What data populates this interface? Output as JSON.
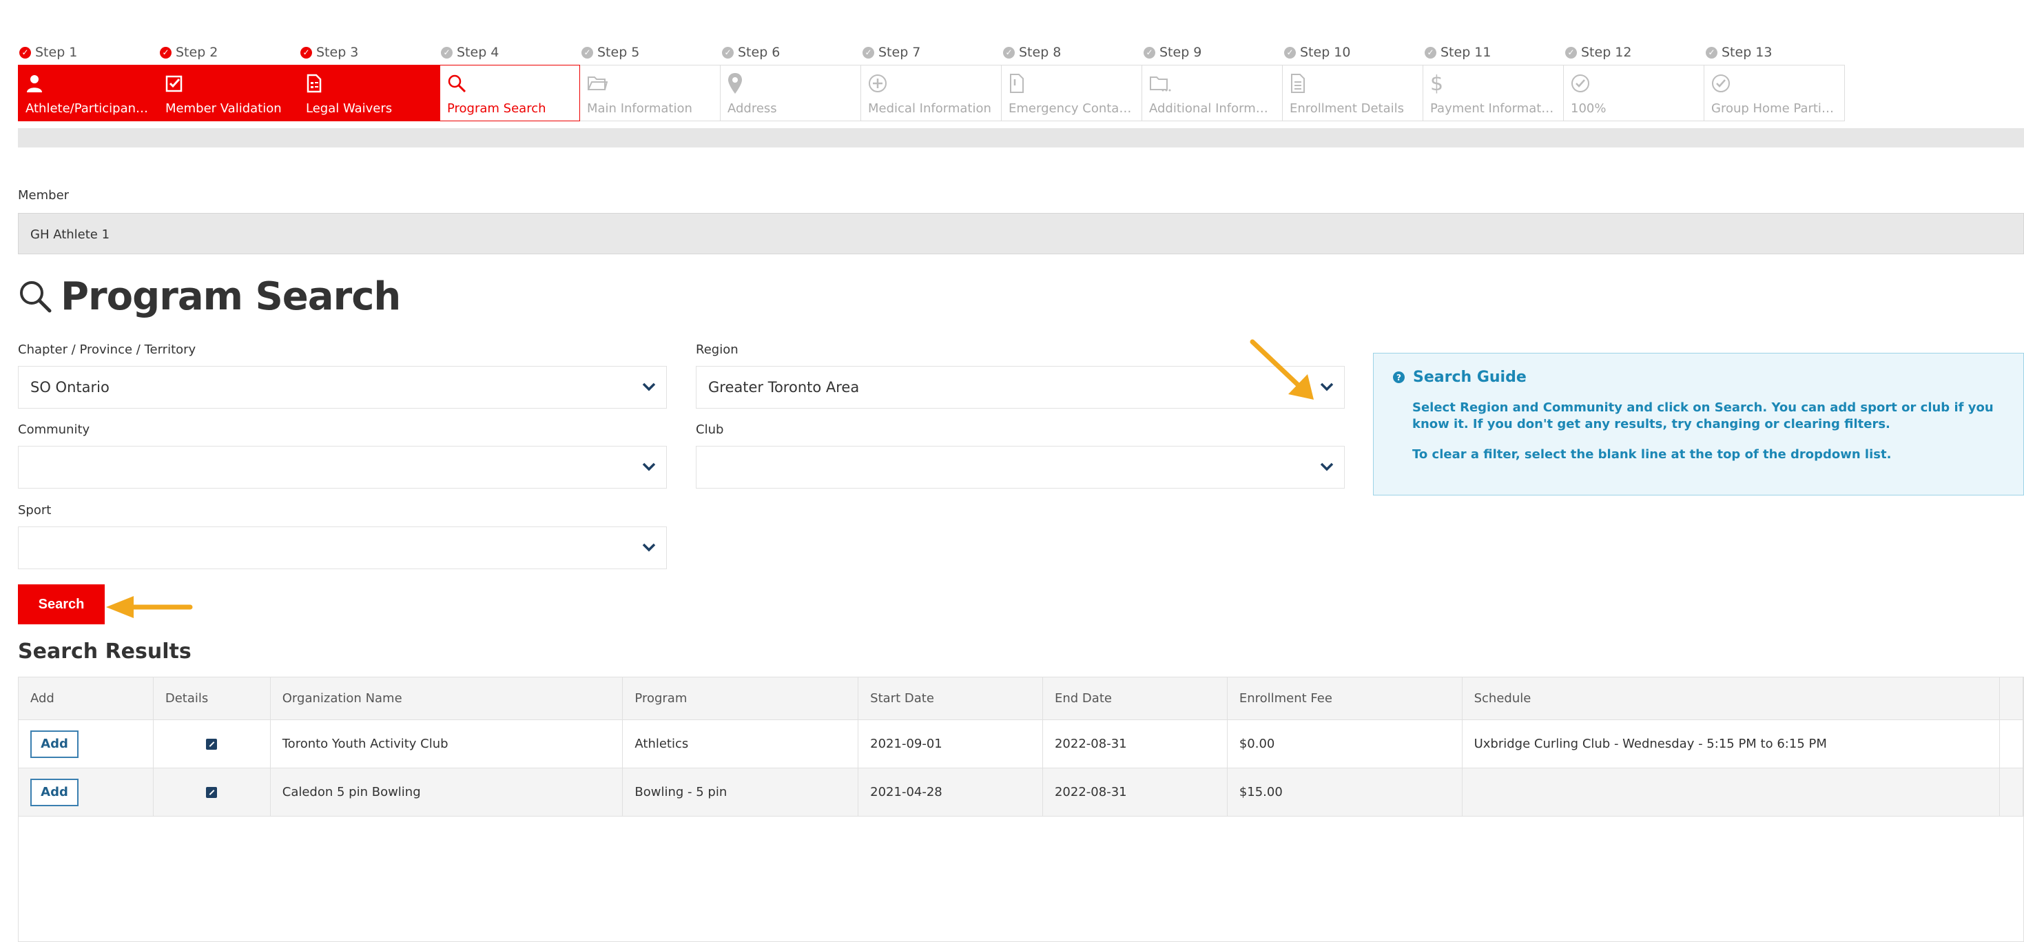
{
  "steps": [
    {
      "step": "Step 1",
      "label": "Athlete/Participant Info",
      "icon": "person-icon",
      "state": "done"
    },
    {
      "step": "Step 2",
      "label": "Member Validation",
      "icon": "checkbox-icon",
      "state": "done"
    },
    {
      "step": "Step 3",
      "label": "Legal Waivers",
      "icon": "document-icon",
      "state": "done"
    },
    {
      "step": "Step 4",
      "label": "Program Search",
      "icon": "search-icon",
      "state": "active"
    },
    {
      "step": "Step 5",
      "label": "Main Information",
      "icon": "folder-icon",
      "state": "pending"
    },
    {
      "step": "Step 6",
      "label": "Address",
      "icon": "map-pin-icon",
      "state": "pending"
    },
    {
      "step": "Step 7",
      "label": "Medical Information",
      "icon": "plus-circle-icon",
      "state": "pending"
    },
    {
      "step": "Step 8",
      "label": "Emergency Contacts",
      "icon": "doc-alert-icon",
      "state": "pending"
    },
    {
      "step": "Step 9",
      "label": "Additional Information",
      "icon": "folder-dots-icon",
      "state": "pending"
    },
    {
      "step": "Step 10",
      "label": "Enrollment Details",
      "icon": "file-lines-icon",
      "state": "pending"
    },
    {
      "step": "Step 11",
      "label": "Payment Information",
      "icon": "dollar-icon",
      "state": "pending"
    },
    {
      "step": "Step 12",
      "label": "100%",
      "icon": "check-circle-icon",
      "state": "pending"
    },
    {
      "step": "Step 13",
      "label": "Group Home Particip...",
      "icon": "check-circle-icon",
      "state": "pending"
    }
  ],
  "member": {
    "label": "Member",
    "value": "GH Athlete 1"
  },
  "page_title": "Program Search",
  "filters": {
    "chapter": {
      "label": "Chapter / Province / Territory",
      "value": "SO Ontario"
    },
    "region": {
      "label": "Region",
      "value": "Greater Toronto Area"
    },
    "community": {
      "label": "Community",
      "value": ""
    },
    "club": {
      "label": "Club",
      "value": ""
    },
    "sport": {
      "label": "Sport",
      "value": ""
    }
  },
  "guide": {
    "title": "Search Guide",
    "p1": "Select Region and Community and click on Search. You can add sport or club if you know it. If you don't get any results, try changing or clearing filters.",
    "p2": "To clear a filter, select the blank line at the top of the dropdown list."
  },
  "search_label": "Search",
  "results": {
    "title": "Search Results",
    "headers": [
      "Add",
      "Details",
      "Organization Name",
      "Program",
      "Start Date",
      "End Date",
      "Enrollment Fee",
      "Schedule"
    ],
    "rows": [
      {
        "add": "Add",
        "org": "Toronto Youth Activity Club",
        "program": "Athletics",
        "start": "2021-09-01",
        "end": "2022-08-31",
        "fee": "$0.00",
        "schedule": "Uxbridge Curling Club - Wednesday - 5:15 PM to 6:15 PM"
      },
      {
        "add": "Add",
        "org": "Caledon 5 pin Bowling",
        "program": "Bowling - 5 pin",
        "start": "2021-04-28",
        "end": "2022-08-31",
        "fee": "$15.00",
        "schedule": ""
      }
    ]
  },
  "colors": {
    "brand_red": "#ee0000",
    "guide_blue": "#1b87b5",
    "arrow_orange": "#f2a81d"
  }
}
